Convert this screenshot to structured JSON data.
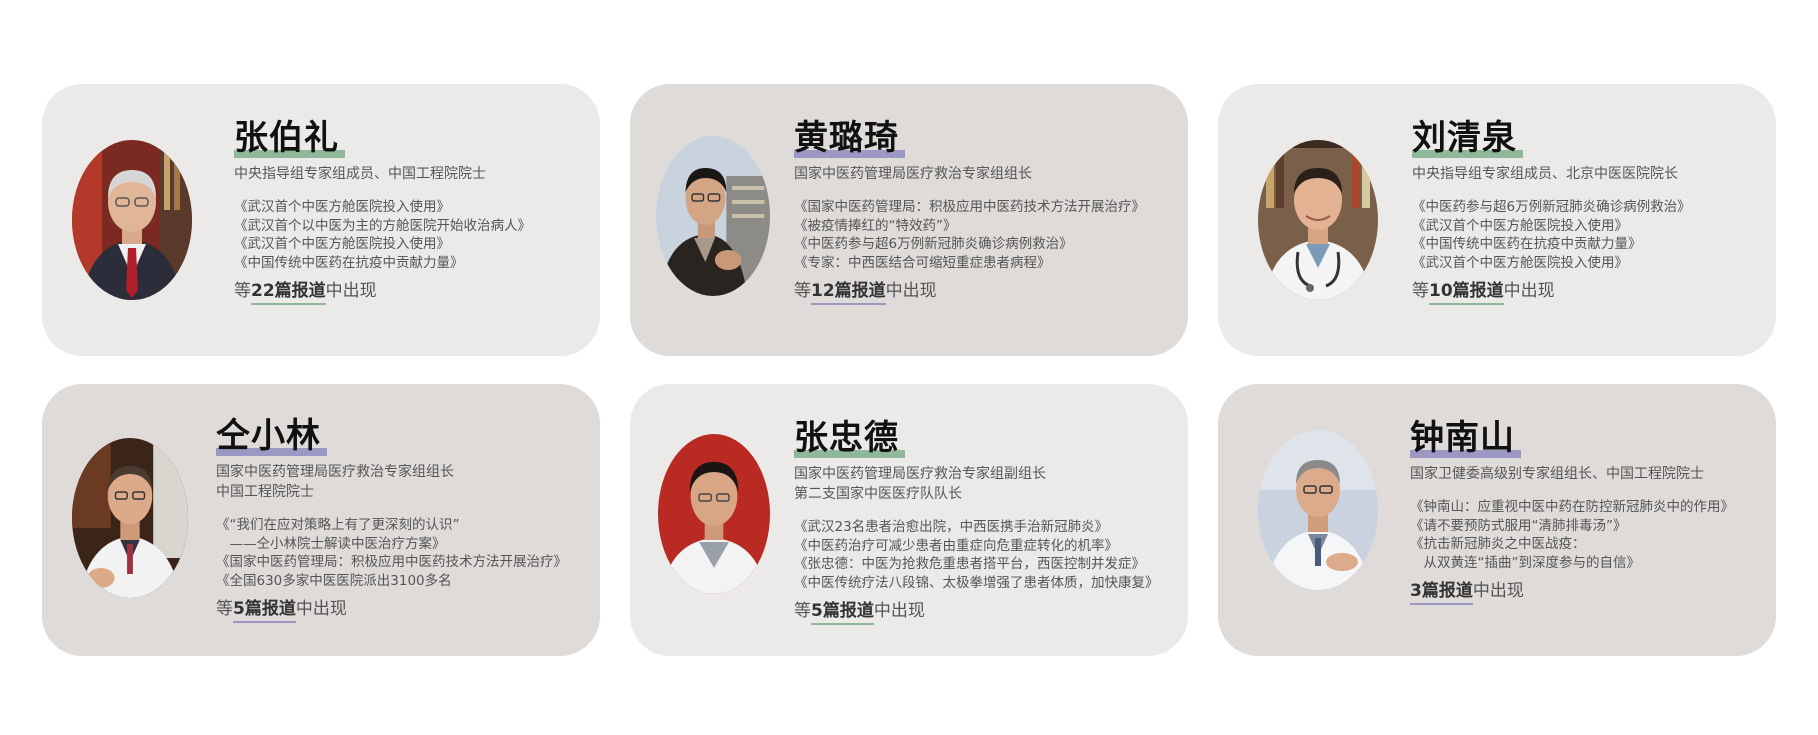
{
  "accent_colors": {
    "green": "#8fb89a",
    "purple": "#9c98c4",
    "card_light": "#ebeae8",
    "card_dark": "#dedbd9"
  },
  "cards": [
    {
      "name": "张伯礼",
      "titles": [
        "中央指导组专家组成员、中国工程院院士"
      ],
      "reports": [
        "《武汉首个中医方舱医院投入使用》",
        "《武汉首个以中医为主的方舱医院开始收治病人》",
        "《武汉首个中医方舱医院投入使用》",
        "《中国传统中医药在抗疫中贡献力量》"
      ],
      "footer_prefix": "等",
      "footer_count": "22篇报道",
      "footer_suffix": "中出现"
    },
    {
      "name": "黄璐琦",
      "titles": [
        "国家中医药管理局医疗救治专家组组长"
      ],
      "reports": [
        "《国家中医药管理局：积极应用中医药技术方法开展治疗》",
        "《被疫情捧红的“特效药”》",
        "《中医药参与超6万例新冠肺炎确诊病例救治》",
        "《专家：中西医结合可缩短重症患者病程》"
      ],
      "footer_prefix": "等",
      "footer_count": "12篇报道",
      "footer_suffix": "中出现"
    },
    {
      "name": "刘清泉",
      "titles": [
        "中央指导组专家组成员、北京中医医院院长"
      ],
      "reports": [
        "《中医药参与超6万例新冠肺炎确诊病例救治》",
        "《武汉首个中医方舱医院投入使用》",
        "《中国传统中医药在抗疫中贡献力量》",
        "《武汉首个中医方舱医院投入使用》"
      ],
      "footer_prefix": "等",
      "footer_count": "10篇报道",
      "footer_suffix": "中出现"
    },
    {
      "name": "仝小林",
      "titles": [
        "国家中医药管理局医疗救治专家组组长",
        "中国工程院院士"
      ],
      "reports": [
        "《“我们在应对策略上有了更深刻的认识”",
        "　——仝小林院士解读中医治疗方案》",
        "《国家中医药管理局：积极应用中医药技术方法开展治疗》",
        "《全国630多家中医医院派出3100多名"
      ],
      "footer_prefix": "等",
      "footer_count": "5篇报道",
      "footer_suffix": "中出现"
    },
    {
      "name": "张忠德",
      "titles": [
        "国家中医药管理局医疗救治专家组副组长",
        "第二支国家中医医疗队队长"
      ],
      "reports": [
        "《武汉23名患者治愈出院，中西医携手治新冠肺炎》",
        "《中医药治疗可减少患者由重症向危重症转化的机率》",
        "《张忠德：中医为抢救危重患者搭平台，西医控制并发症》",
        "《中医传统疗法八段锦、太极拳增强了患者体质，加快康复》"
      ],
      "footer_prefix": "等",
      "footer_count": "5篇报道",
      "footer_suffix": "中出现"
    },
    {
      "name": "钟南山",
      "titles": [
        "国家卫健委高级别专家组组长、中国工程院院士"
      ],
      "reports": [
        "《钟南山：应重视中医中药在防控新冠肺炎中的作用》",
        "《请不要预防式服用“清肺排毒汤”》",
        "《抗击新冠肺炎之中医战疫：",
        "　从双黄连“插曲”到深度参与的自信》"
      ],
      "footer_prefix": "",
      "footer_count": "3篇报道",
      "footer_suffix": "中出现"
    }
  ]
}
